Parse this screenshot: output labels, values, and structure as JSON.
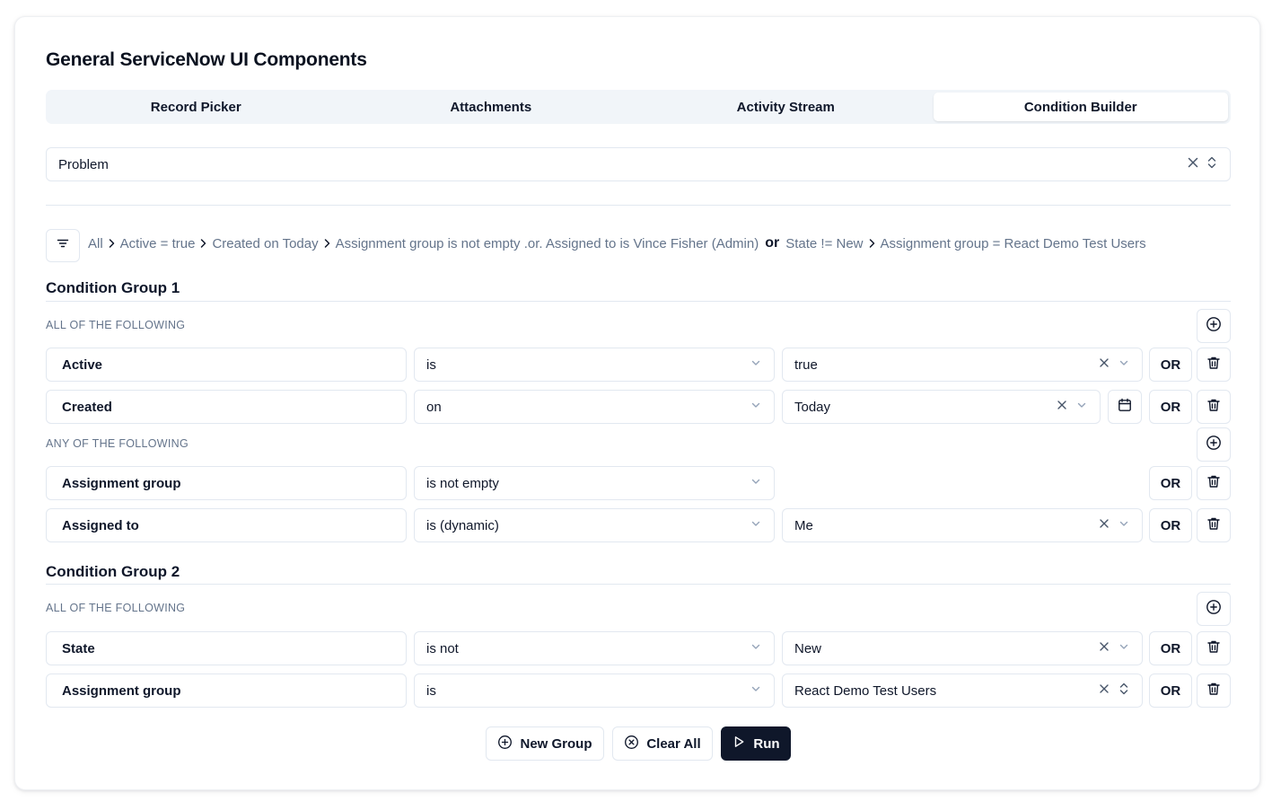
{
  "page_title": "General ServiceNow UI Components",
  "tabs": [
    {
      "label": "Record Picker",
      "active": false
    },
    {
      "label": "Attachments",
      "active": false
    },
    {
      "label": "Activity Stream",
      "active": false
    },
    {
      "label": "Condition Builder",
      "active": true
    }
  ],
  "table_select": {
    "value": "Problem"
  },
  "breadcrumb": {
    "items": [
      "All",
      "Active = true",
      "Created on Today",
      "Assignment group is not empty .or. Assigned to is Vince Fisher (Admin)"
    ],
    "or_word": "or",
    "items_after_or": [
      "State != New",
      "Assignment group = React Demo Test Users"
    ]
  },
  "groups": [
    {
      "title": "Condition Group 1",
      "sections": [
        {
          "label": "ALL OF THE FOLLOWING",
          "conditions": [
            {
              "field": "Active",
              "operator": "is",
              "value": "true"
            },
            {
              "field": "Created",
              "operator": "on",
              "value": "Today"
            }
          ]
        },
        {
          "label": "ANY OF THE FOLLOWING",
          "conditions": [
            {
              "field": "Assignment group",
              "operator": "is not empty",
              "value": ""
            },
            {
              "field": "Assigned to",
              "operator": "is (dynamic)",
              "value": "Me"
            }
          ]
        }
      ]
    },
    {
      "title": "Condition Group 2",
      "sections": [
        {
          "label": "ALL OF THE FOLLOWING",
          "conditions": [
            {
              "field": "State",
              "operator": "is not",
              "value": "New"
            },
            {
              "field": "Assignment group",
              "operator": "is",
              "value": "React Demo Test Users"
            }
          ]
        }
      ]
    }
  ],
  "or_label": "OR",
  "actions": {
    "new_group": "New Group",
    "clear_all": "Clear All",
    "run": "Run"
  },
  "icons": {
    "filter": "filter-lines-icon",
    "clear": "x-icon",
    "chevron": "chevron-down-icon",
    "updown": "chevron-up-down-icon",
    "calendar": "calendar-icon",
    "add": "plus-circle-icon",
    "delete": "trash-icon",
    "run": "play-icon",
    "clear_all": "x-circle-icon"
  },
  "colors": {
    "primary": "#0f172a",
    "muted": "#64748b",
    "border": "#e2e8f0",
    "tabs_bg": "#f1f5f9"
  }
}
